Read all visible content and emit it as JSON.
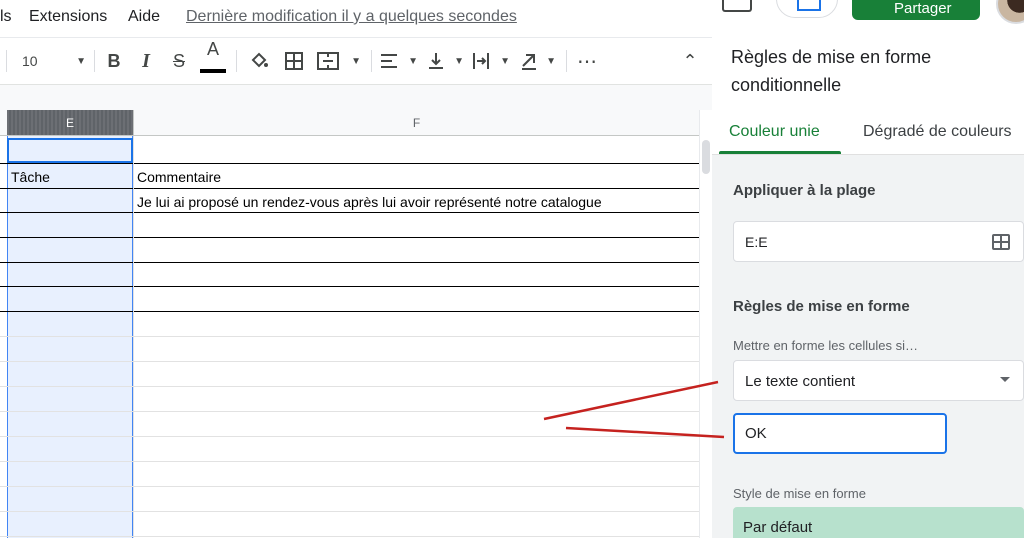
{
  "menu": {
    "items": [
      "ls",
      "Extensions",
      "Aide"
    ],
    "last_modified": "Dernière modification il y a quelques secondes",
    "share_label": "Partager"
  },
  "toolbar": {
    "font_size": "10",
    "bold": "B",
    "italic": "I",
    "strike": "S",
    "text_color": "A",
    "more": "⋯",
    "collapse": "⌃"
  },
  "sheet": {
    "columns": [
      "E",
      "F"
    ],
    "header_row": {
      "E": "Tâche",
      "F": "Commentaire"
    },
    "data_row": {
      "F": "Je lui ai proposé un rendez-vous après lui avoir représenté notre catalogue"
    }
  },
  "panel": {
    "title": "Règles de mise en forme conditionnelle",
    "tabs": [
      "Couleur unie",
      "Dégradé de couleurs"
    ],
    "apply_range_label": "Appliquer à la plage",
    "range_value": "E:E",
    "rules_label": "Règles de mise en forme",
    "condition_label": "Mettre en forme les cellules si…",
    "condition_value": "Le texte contient",
    "value": "OK",
    "style_label": "Style de mise en forme",
    "style_value": "Par défaut"
  },
  "colors": {
    "accent_green": "#188038",
    "selection_blue": "#1a73e8",
    "default_style_fill": "#b7e1cd",
    "annotation_red": "#c5221f"
  }
}
